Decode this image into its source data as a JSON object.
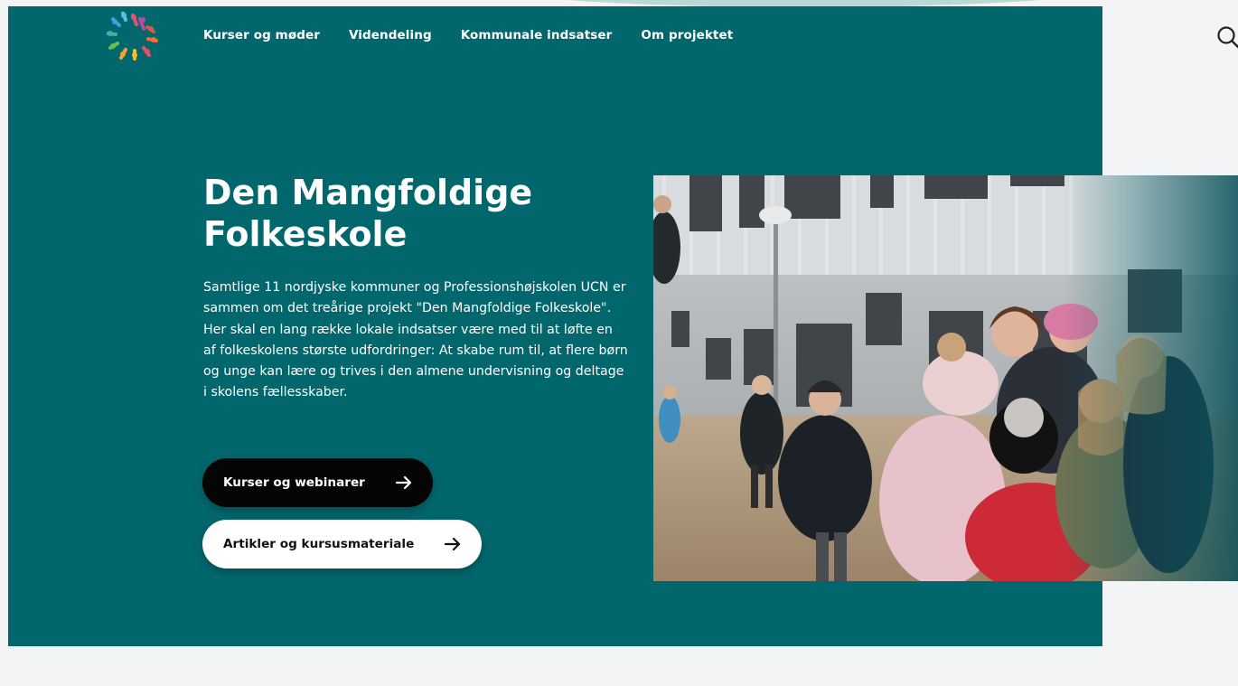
{
  "nav": {
    "items": [
      "Kurser og møder",
      "Videndeling",
      "Kommunale indsatser",
      "Om projektet"
    ],
    "logo_icon": "children-circle-logo-icon",
    "search_icon": "search-icon"
  },
  "hero": {
    "title": "Den Mangfoldige Folkeskole",
    "text": "Samtlige 11 nordjyske kommuner og Professionshøjskolen UCN er sammen om det treårige projekt \"Den Mangfoldige Folkeskole\". Her skal en lang række lokale indsatser være med til at løfte en af folkeskolens største udfordringer: At skabe rum til, at flere børn og unge kan lære og trives i den almene undervisning og deltage i skolens fællesskaber.",
    "primary_button": "Kurser og webinarer",
    "secondary_button": "Artikler og kursusmateriale",
    "arrow_icon": "arrow-right-icon",
    "image_subject": "school-children-hugging-photo"
  },
  "colors": {
    "hero_bg": "#02676d",
    "page_bg": "#f2f4f5",
    "dark_button": "#050505",
    "light_button": "#ffffff"
  }
}
